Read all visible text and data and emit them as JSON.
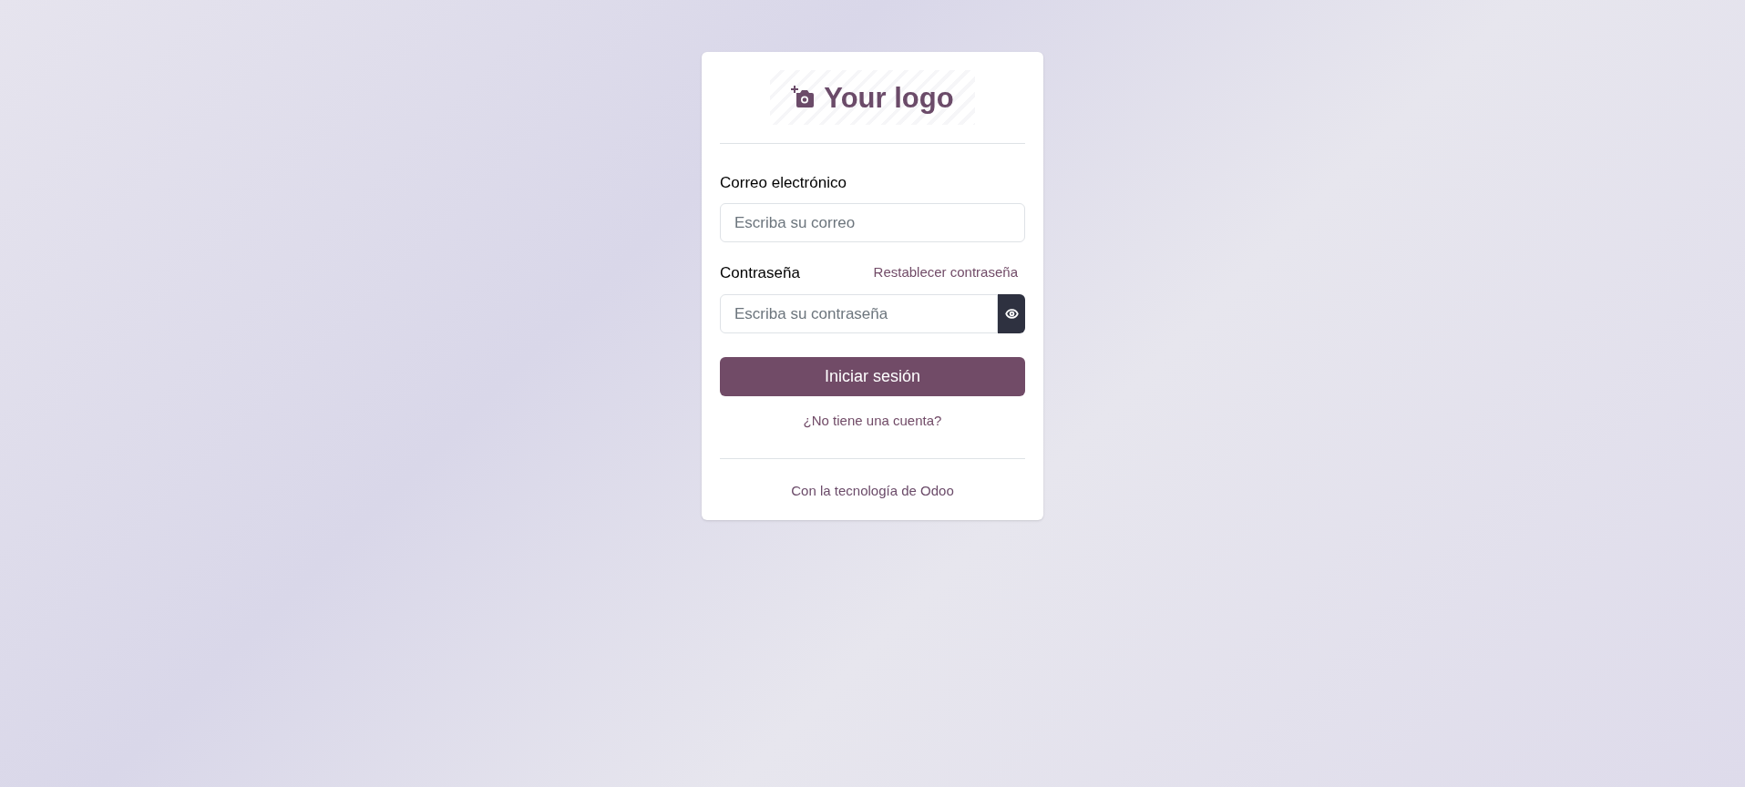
{
  "logo": {
    "text": "Your logo"
  },
  "email": {
    "label": "Correo electrónico",
    "placeholder": "Escriba su correo"
  },
  "password": {
    "label": "Contraseña",
    "reset_link": "Restablecer contraseña",
    "placeholder": "Escriba su contraseña"
  },
  "submit": "Iniciar sesión",
  "signup_link": "¿No tiene una cuenta?",
  "footer": "Con la tecnología de Odoo"
}
